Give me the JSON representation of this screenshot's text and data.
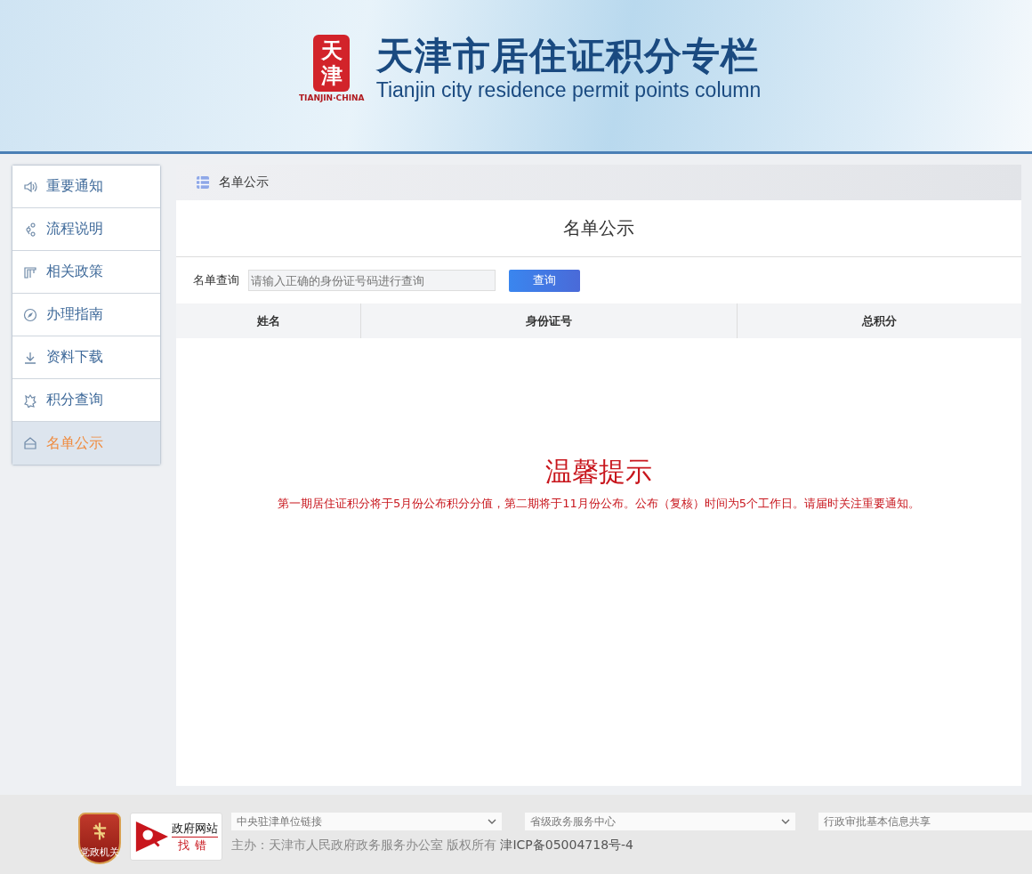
{
  "header": {
    "seal_text": "天津",
    "seal_caption": "TIANJIN·CHINA",
    "title": "天津市居住证积分专栏",
    "subtitle": "Tianjin city residence permit points column"
  },
  "sidebar": {
    "items": [
      {
        "label": "重要通知",
        "selected": false
      },
      {
        "label": "流程说明",
        "selected": false
      },
      {
        "label": "相关政策",
        "selected": false
      },
      {
        "label": "办理指南",
        "selected": false
      },
      {
        "label": "资料下载",
        "selected": false
      },
      {
        "label": "积分查询",
        "selected": false
      },
      {
        "label": "名单公示",
        "selected": true
      }
    ]
  },
  "breadcrumb": "名单公示",
  "page_title": "名单公示",
  "search": {
    "label": "名单查询",
    "placeholder": "请输入正确的身份证号码进行查询",
    "button": "查询"
  },
  "table": {
    "columns": [
      "姓名",
      "身份证号",
      "总积分"
    ]
  },
  "notice": {
    "title": "温馨提示",
    "text": "第一期居住证积分将于5月份公布积分分值，第二期将于11月份公布。公布（复核）时间为5个工作日。请届时关注重要通知。"
  },
  "footer": {
    "party_badge": "党政机关",
    "gov_badge": {
      "top": "政府网站",
      "bottom": "找错"
    },
    "selects": [
      {
        "value": "中央驻津单位链接",
        "kind": "dropdown"
      },
      {
        "value": "省级政务服务中心",
        "kind": "dropdown"
      },
      {
        "value": "行政审批基本信息共享",
        "kind": "plain"
      }
    ],
    "copyright": "主办：天津市人民政府政务服务办公室 版权所有",
    "icp": "津ICP备05004718号-4"
  }
}
